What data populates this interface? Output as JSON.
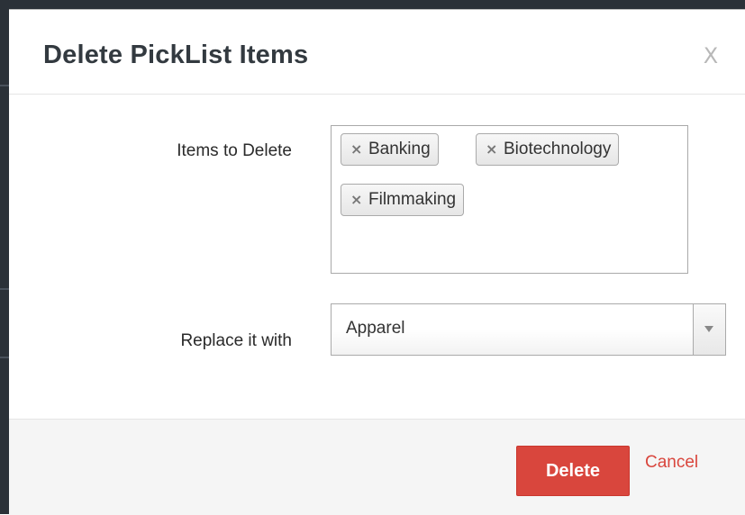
{
  "dialog": {
    "title": "Delete PickList Items",
    "close_label": "X"
  },
  "form": {
    "items_label": "Items to Delete",
    "selected_items": [
      {
        "label": "Banking"
      },
      {
        "label": "Biotechnology"
      },
      {
        "label": "Filmmaking"
      }
    ],
    "replace_label": "Replace it with",
    "replace_value": "Apparel"
  },
  "footer": {
    "delete_label": "Delete",
    "cancel_label": "Cancel"
  },
  "icons": {
    "tag_remove": "close-icon",
    "select_arrow": "chevron-down-icon"
  },
  "colors": {
    "accent": "#d9463d",
    "title": "#333a40"
  }
}
